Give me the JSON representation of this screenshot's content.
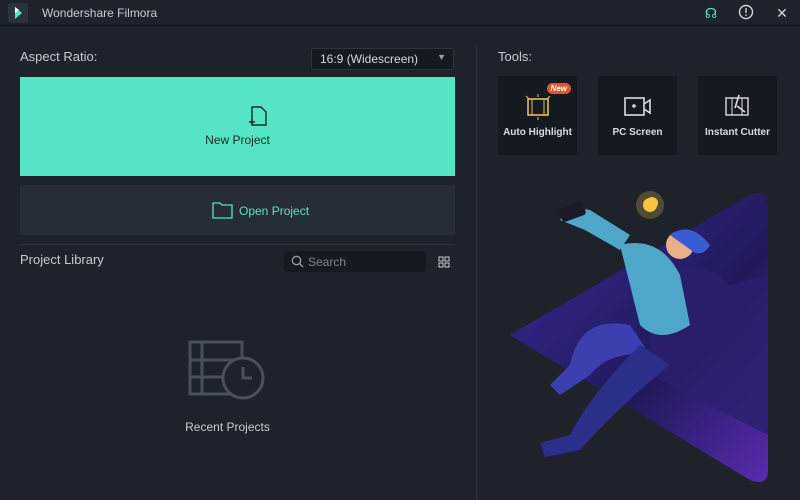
{
  "window": {
    "title": "Wondershare Filmora",
    "icons": [
      "support-headset-icon",
      "info-icon",
      "close-icon"
    ],
    "accent": "#56e5c4"
  },
  "left": {
    "aspect_label": "Aspect Ratio:",
    "aspect_value": "16:9 (Widescreen)",
    "new_project": "New Project",
    "open_project": "Open Project",
    "library_label": "Project Library",
    "search_placeholder": "Search",
    "recent_label": "Recent Projects"
  },
  "tools": {
    "label": "Tools:",
    "items": [
      {
        "label": "Auto Highlight",
        "badge": "New",
        "icon": "auto-highlight-icon"
      },
      {
        "label": "PC Screen",
        "icon": "screen-record-icon"
      },
      {
        "label": "Instant Cutter",
        "icon": "instant-cutter-icon"
      }
    ]
  }
}
